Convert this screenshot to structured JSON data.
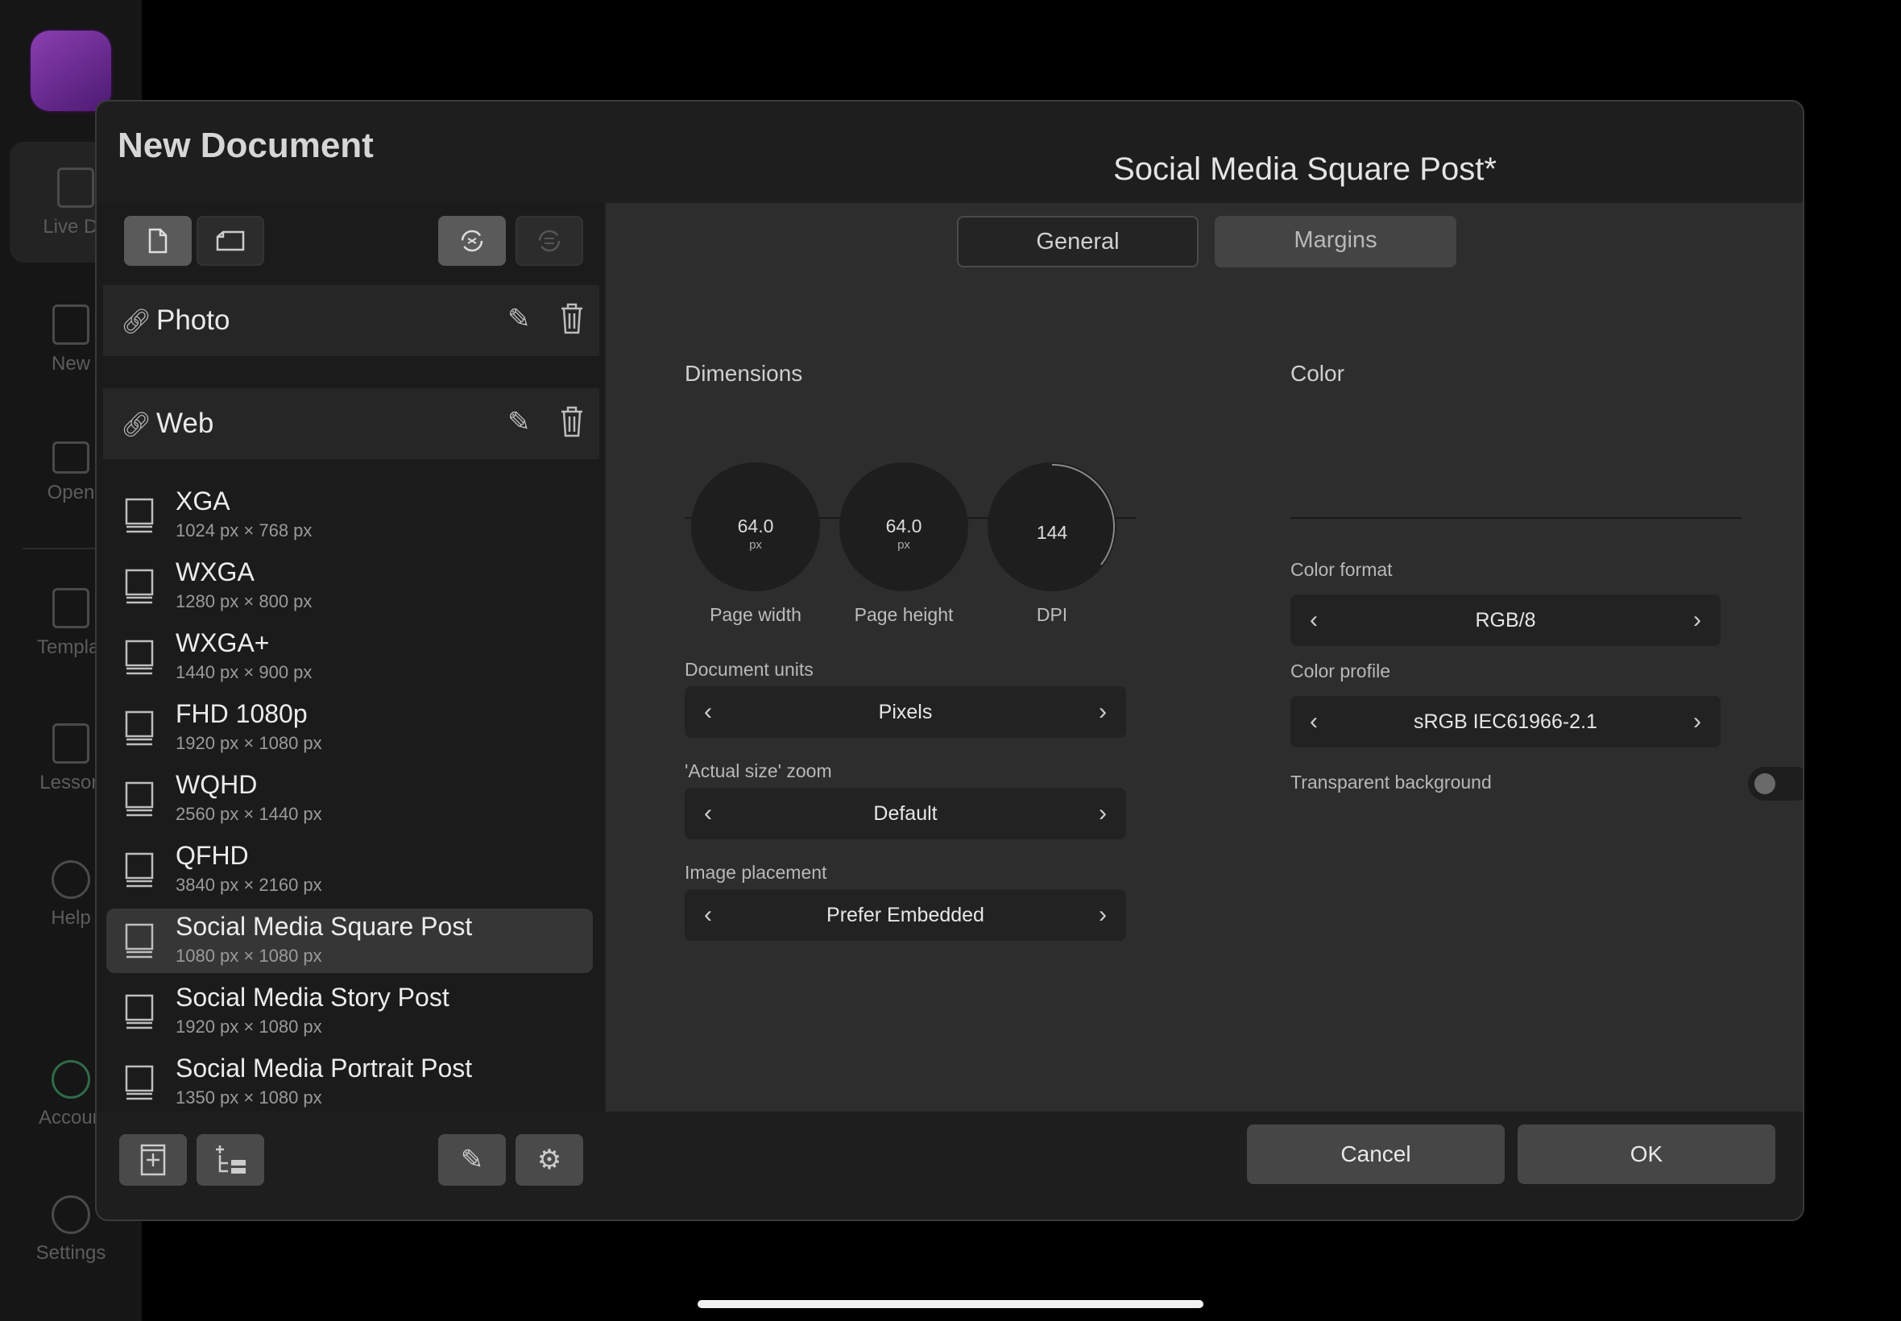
{
  "rail": {
    "items": [
      {
        "label": "Live Do"
      },
      {
        "label": "New"
      },
      {
        "label": "Open"
      },
      {
        "label": "Templat"
      },
      {
        "label": "Lesson"
      },
      {
        "label": "Help"
      },
      {
        "label": "Accoun"
      },
      {
        "label": "Settings"
      }
    ]
  },
  "dialog": {
    "title": "New Document",
    "preset_title": "Social Media Square Post*"
  },
  "groups": {
    "photo": {
      "name": "Photo"
    },
    "web": {
      "name": "Web"
    }
  },
  "presets": [
    {
      "name": "XGA",
      "size": "1024 px × 768 px"
    },
    {
      "name": "WXGA",
      "size": "1280 px × 800 px"
    },
    {
      "name": "WXGA+",
      "size": "1440 px × 900 px"
    },
    {
      "name": "FHD 1080p",
      "size": "1920 px × 1080 px"
    },
    {
      "name": "WQHD",
      "size": "2560 px × 1440 px"
    },
    {
      "name": "QFHD",
      "size": "3840 px × 2160 px"
    },
    {
      "name": "Social Media Square Post",
      "size": "1080 px × 1080 px",
      "selected": true
    },
    {
      "name": "Social Media Story Post",
      "size": "1920 px × 1080 px"
    },
    {
      "name": "Social Media Portrait Post",
      "size": "1350 px × 1080 px"
    }
  ],
  "tabs": {
    "general": "General",
    "margins": "Margins",
    "active": "General"
  },
  "dimensions": {
    "title": "Dimensions",
    "page_width": {
      "value": "64.0",
      "unit": "px",
      "label": "Page width"
    },
    "page_height": {
      "value": "64.0",
      "unit": "px",
      "label": "Page height"
    },
    "dpi": {
      "value": "144",
      "label": "DPI"
    },
    "document_units": {
      "label": "Document units",
      "value": "Pixels"
    },
    "actual_size_zoom": {
      "label": "'Actual size' zoom",
      "value": "Default"
    },
    "image_placement": {
      "label": "Image placement",
      "value": "Prefer Embedded"
    }
  },
  "color": {
    "title": "Color",
    "color_format": {
      "label": "Color format",
      "value": "RGB/8"
    },
    "color_profile": {
      "label": "Color profile",
      "value": "sRGB IEC61966-2.1"
    },
    "transparent_background": {
      "label": "Transparent background",
      "on": false
    }
  },
  "footer": {
    "cancel": "Cancel",
    "ok": "OK"
  },
  "icons": {
    "portrait": "portrait-page-icon",
    "landscape": "landscape-page-icon",
    "sync": "sync-icon",
    "sync2": "sync-disabled-icon",
    "link": "link-icon",
    "pen": "pen-tool-icon",
    "trash": "trash-icon",
    "device": "monitor-icon",
    "add_preset": "add-preset-icon",
    "add_category": "add-category-icon",
    "style": "pen-tool-icon",
    "gear": "gear-icon"
  },
  "colors": {
    "dialog_bg": "#1e1e1e",
    "panel_bg": "#2d2d2d",
    "selected": "#363636",
    "accent_app": "#8a3fb0"
  }
}
